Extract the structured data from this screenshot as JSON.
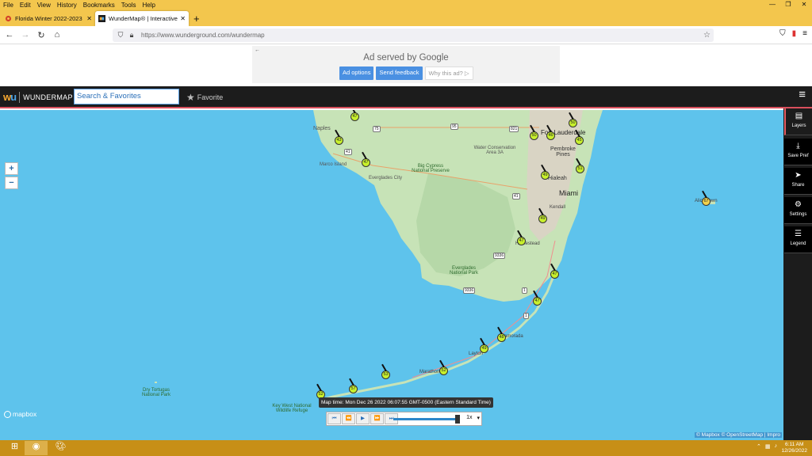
{
  "menu": [
    "File",
    "Edit",
    "View",
    "History",
    "Bookmarks",
    "Tools",
    "Help"
  ],
  "tabs": [
    {
      "label": "Florida Winter 2022-2023 - Page",
      "active": false
    },
    {
      "label": "WunderMap® | Interactive Wea",
      "active": true
    }
  ],
  "url": {
    "text": "https://www.wunderground.com/wundermap"
  },
  "ad": {
    "title": "Ad served by Google",
    "options": "Ad options",
    "feedback": "Send feedback",
    "why": "Why this ad? ▷"
  },
  "header": {
    "brand_name": "WUNDERMAP",
    "search_placeholder": "Search & Favorites",
    "favorite": "Favorite"
  },
  "sidebar": [
    {
      "label": "Layers",
      "icon": "layers-icon"
    },
    {
      "label": "Save Pref",
      "icon": "save-icon"
    },
    {
      "label": "Share",
      "icon": "share-icon"
    },
    {
      "label": "Settings",
      "icon": "gear-icon"
    },
    {
      "label": "Legend",
      "icon": "list-icon"
    }
  ],
  "map": {
    "places": [
      {
        "name": "Naples"
      },
      {
        "name": "Marco Island"
      },
      {
        "name": "Everglades City"
      },
      {
        "name": "Big Cypress National Preserve"
      },
      {
        "name": "Water Conservation Area 3A"
      },
      {
        "name": "Fort Lauderdale"
      },
      {
        "name": "Pembroke Pines"
      },
      {
        "name": "Hialeah"
      },
      {
        "name": "Miami"
      },
      {
        "name": "Kendall"
      },
      {
        "name": "Homestead"
      },
      {
        "name": "Everglades National Park"
      },
      {
        "name": "Islamorada"
      },
      {
        "name": "Layton"
      },
      {
        "name": "Marathon"
      },
      {
        "name": "Key West National Wildlife Refuge"
      },
      {
        "name": "Dry Tortugas National Park"
      },
      {
        "name": "Alice Town"
      }
    ],
    "stations": [
      "47",
      "43",
      "47",
      "50",
      "45",
      "46",
      "51",
      "50",
      "49",
      "49",
      "47",
      "47",
      "47",
      "48",
      "49",
      "52",
      "53",
      "57",
      "52",
      "67"
    ],
    "roads": [
      "41",
      "75",
      "95",
      "41",
      "821",
      "9336",
      "9336",
      "1",
      "1"
    ],
    "mapbox_label": "mapbox",
    "attribution": "© Mapbox © OpenStreetMap | Impro",
    "map_time": "Map time: Mon Dec 26 2022 06:07:55 GMT-0500 (Eastern Standard Time)",
    "speed": "1x"
  },
  "taskbar": {
    "time": "6:11 AM",
    "date": "12/26/2022"
  }
}
